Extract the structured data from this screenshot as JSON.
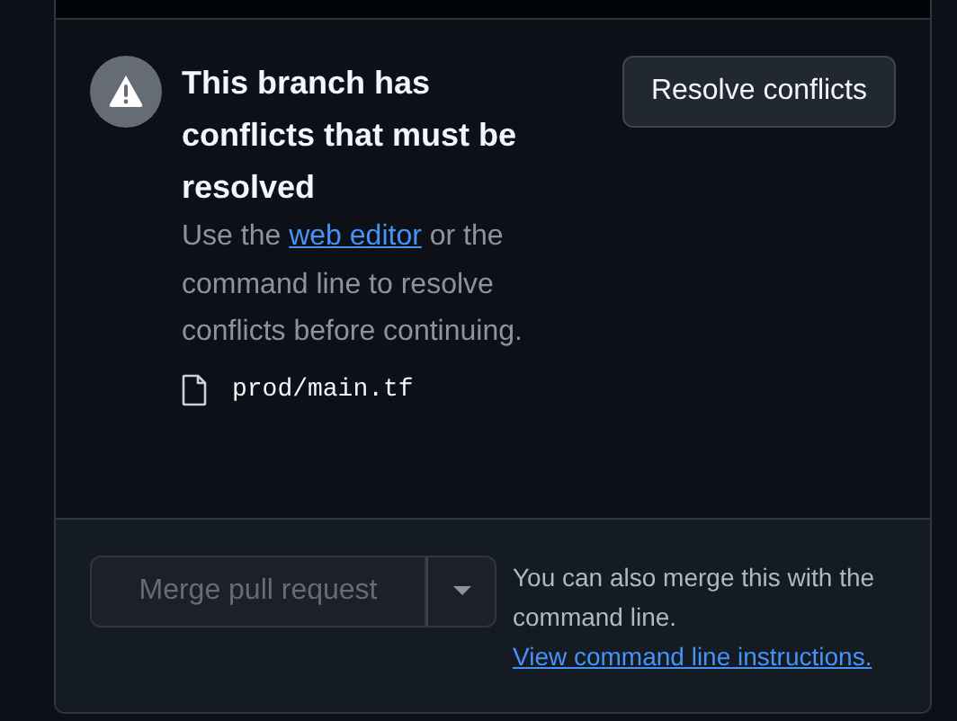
{
  "conflict": {
    "title": "This branch has conflicts that must be resolved",
    "message_before": "Use the ",
    "link": "web editor",
    "message_after": " or the command line to resolve conflicts before continuing.",
    "files": [
      {
        "name": "prod/main.tf"
      }
    ],
    "resolve_button": "Resolve conflicts"
  },
  "merge": {
    "button": {
      "label": "Merge pull request",
      "disabled": true
    },
    "note": "You can also merge this with the command line.",
    "link": "View command line instructions."
  }
}
